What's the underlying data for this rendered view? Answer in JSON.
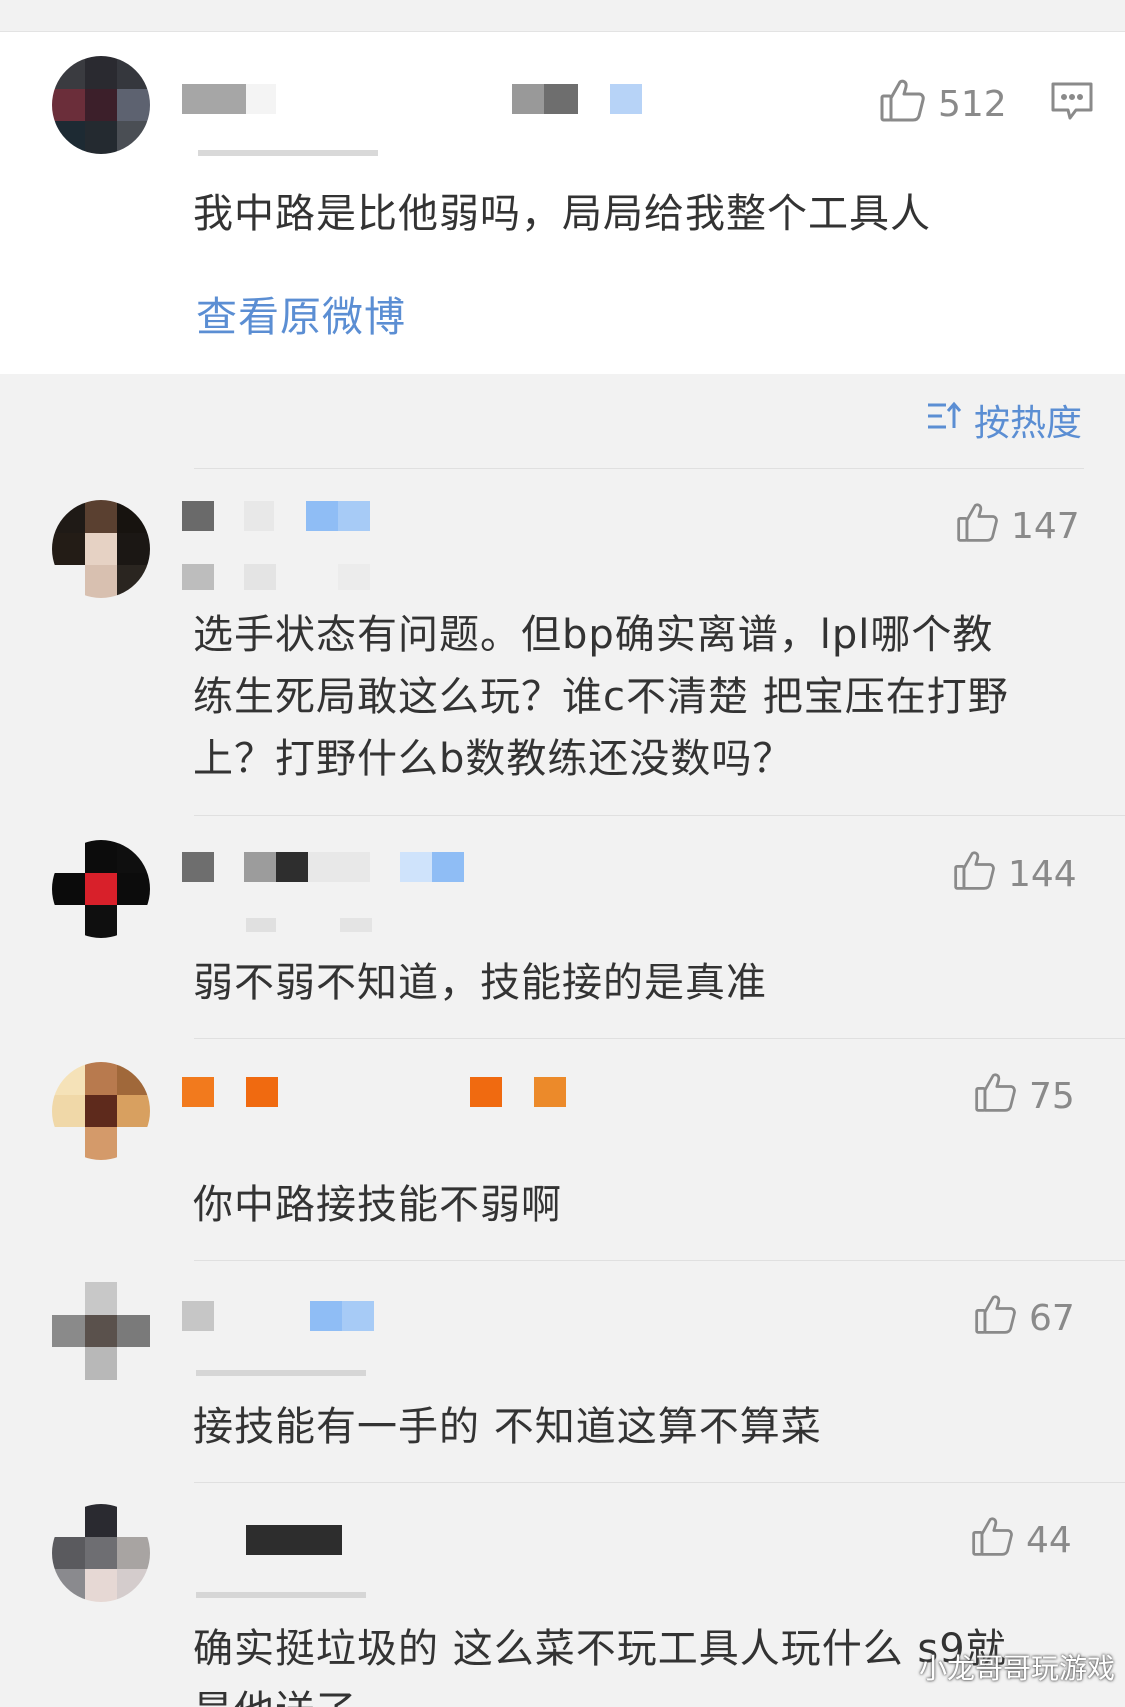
{
  "post": {
    "likes": "512",
    "content": "我中路是比他弱吗，局局给我整个工具人",
    "view_original": "查看原微博"
  },
  "sort": {
    "label": "按热度"
  },
  "comments": [
    {
      "likes": "147",
      "lines": [
        "选手状态有问题。但bp确实离谱，lpl哪个教",
        "练生死局敢这么玩？谁c不清楚 把宝压在打野",
        "上？打野什么b数教练还没数吗？"
      ]
    },
    {
      "likes": "144",
      "lines": [
        "弱不弱不知道，技能接的是真准"
      ]
    },
    {
      "likes": "75",
      "lines": [
        "你中路接技能不弱啊"
      ]
    },
    {
      "likes": "67",
      "lines": [
        "接技能有一手的 不知道这算不算菜"
      ]
    },
    {
      "likes": "44",
      "lines": [
        "确实挺垃圾的 这么菜不玩工具人玩什么  s9就",
        "是他送了"
      ]
    }
  ],
  "watermark": "小龙哥哥玩游戏",
  "colors": {
    "accent": "#5b8ed3",
    "like_gray": "#8a8a8a",
    "text": "#333333"
  },
  "icons": {
    "like": "thumbs-up-icon",
    "comment": "comment-bubble-icon",
    "sort": "sort-lines-icon"
  }
}
